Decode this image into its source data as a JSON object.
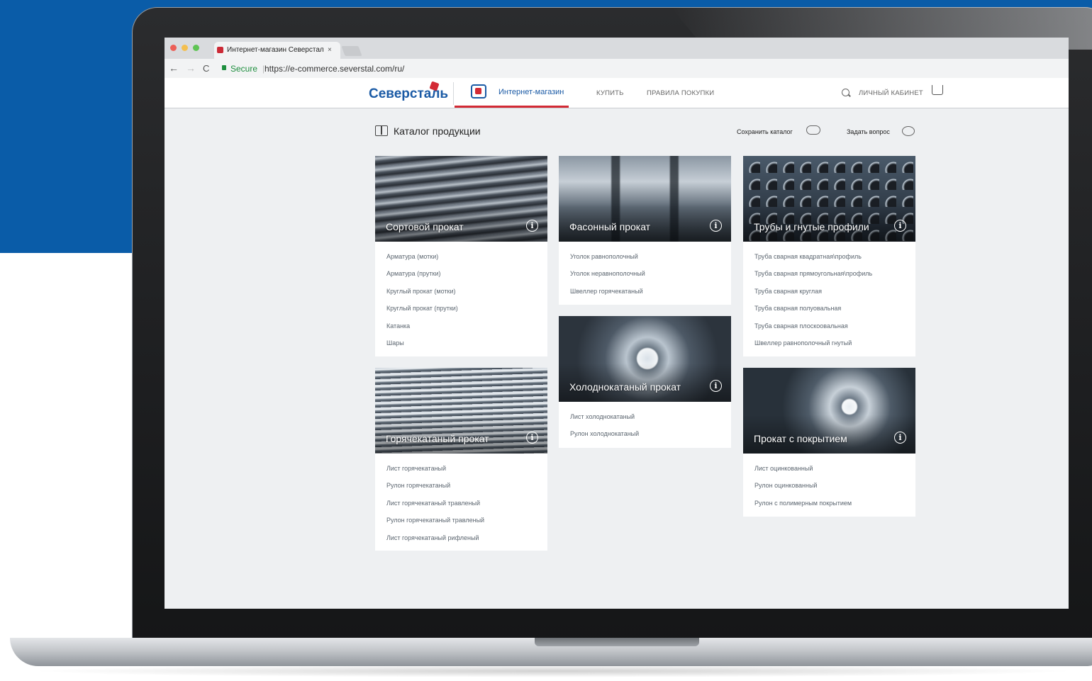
{
  "browser": {
    "tab_title": "Интернет-магазин Северстал",
    "tab_close": "×",
    "secure_label": "Secure",
    "url_separator": "|",
    "url": "https://e-commerce.severstal.com/ru/"
  },
  "header": {
    "brand": "Северсталь",
    "shop_label": "Интернет-магазин",
    "nav": [
      "КУПИТЬ",
      "ПРАВИЛА ПОКУПКИ"
    ],
    "account_label": "ЛИЧНЫЙ КАБИНЕТ"
  },
  "catalog": {
    "title": "Каталог продукции",
    "save_label": "Сохранить каталог",
    "ask_label": "Задать вопрос"
  },
  "cards": [
    {
      "name": "Сортовой прокат",
      "items": [
        "Арматура (мотки)",
        "Арматура (прутки)",
        "Круглый прокат (мотки)",
        "Круглый прокат (прутки)",
        "Катанка",
        "Шары"
      ]
    },
    {
      "name": "Фасонный прокат",
      "items": [
        "Уголок равнополочный",
        "Уголок неравнополочный",
        "Швеллер горячекатаный"
      ]
    },
    {
      "name": "Трубы и гнутые профили",
      "items": [
        "Труба сварная квадратная\\профиль",
        "Труба сварная прямоугольная\\профиль",
        "Труба сварная круглая",
        "Труба сварная полуовальная",
        "Труба сварная плоскоовальная",
        "Швеллер равнополочный гнутый"
      ]
    },
    {
      "name": "Холоднокатаный прокат",
      "items": [
        "Лист холоднокатаный",
        "Рулон холоднокатаный"
      ]
    },
    {
      "name": "Горячекатаный прокат",
      "items": [
        "Лист горячекатаный",
        "Рулон горячекатаный",
        "Лист горячекатаный травленый",
        "Рулон горячекатаный травленый",
        "Лист горячекатаный рифленый"
      ]
    },
    {
      "name": "Прокат с покрытием",
      "items": [
        "Лист оцинкованный",
        "Рулон оцинкованный",
        "Рулон с полимерным покрытием"
      ]
    }
  ],
  "icons": {
    "info": "i",
    "back": "←",
    "forward": "→",
    "reload": "C"
  },
  "colors": {
    "brand_blue": "#1a5aa5",
    "brand_red": "#d32a35",
    "backdrop_blue": "#0a5ca8"
  }
}
